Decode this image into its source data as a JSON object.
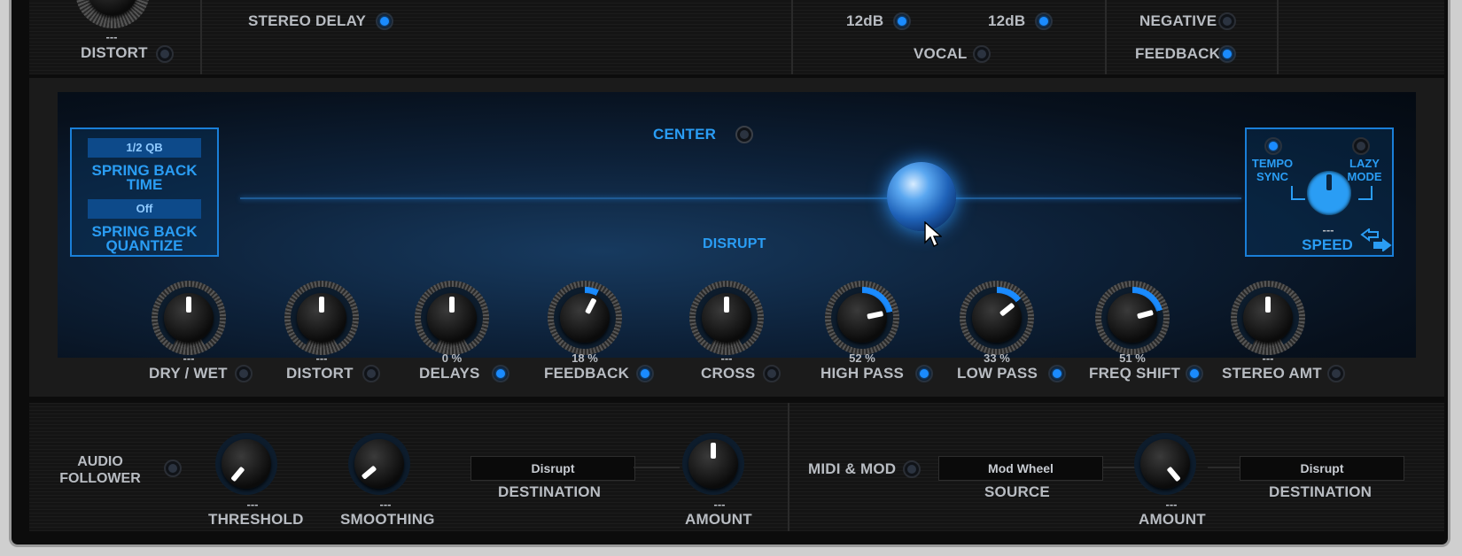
{
  "top": {
    "distort_value": "---",
    "distort_label": "DISTORT",
    "stereo_delay_label": "STEREO DELAY",
    "db_left": "12dB",
    "db_right": "12dB",
    "vocal_label": "VOCAL",
    "negative_label": "NEGATIVE",
    "feedback_label": "FEEDBACK"
  },
  "spring": {
    "time_value": "1/2 QB",
    "time_label_1": "SPRING BACK",
    "time_label_2": "TIME",
    "quantize_value": "Off",
    "quantize_label_1": "SPRING BACK",
    "quantize_label_2": "QUANTIZE"
  },
  "center_label": "CENTER",
  "disrupt_label": "DISRUPT",
  "speed": {
    "tempo_1": "TEMPO",
    "tempo_2": "SYNC",
    "lazy_1": "LAZY",
    "lazy_2": "MODE",
    "value": "---",
    "label": "SPEED"
  },
  "knobs": [
    {
      "label": "DRY / WET",
      "value": "---",
      "led_on": false,
      "level": 0.5
    },
    {
      "label": "DISTORT",
      "value": "---",
      "led_on": false,
      "level": 0.5
    },
    {
      "label": "DELAYS",
      "value": "0 %",
      "led_on": true,
      "level": 0.5
    },
    {
      "label": "FEEDBACK",
      "value": "18 %",
      "led_on": true,
      "level": 0.59
    },
    {
      "label": "CROSS",
      "value": "---",
      "led_on": false,
      "level": 0.5
    },
    {
      "label": "HIGH PASS",
      "value": "52 %",
      "led_on": true,
      "level": 0.76
    },
    {
      "label": "LOW PASS",
      "value": "33 %",
      "led_on": true,
      "level": 0.67
    },
    {
      "label": "FREQ SHIFT",
      "value": "51 %",
      "led_on": true,
      "level": 0.75
    },
    {
      "label": "STEREO AMT",
      "value": "---",
      "led_on": false,
      "level": 0.5
    }
  ],
  "bottom_left": {
    "follower_1": "AUDIO",
    "follower_2": "FOLLOWER",
    "threshold_value": "---",
    "threshold_label": "THRESHOLD",
    "smoothing_value": "---",
    "smoothing_label": "SMOOTHING",
    "destination_value": "Disrupt",
    "destination_label": "DESTINATION",
    "amount_value": "---",
    "amount_label": "AMOUNT"
  },
  "bottom_right": {
    "midi_label": "MIDI & MOD",
    "source_value": "Mod Wheel",
    "source_label": "SOURCE",
    "amount_value": "---",
    "amount_label": "AMOUNT",
    "destination_value": "Disrupt",
    "destination_label": "DESTINATION"
  },
  "colors": {
    "accent": "#1a8bff",
    "label": "#b8bcc2",
    "panel_blue": "#2a9df4"
  },
  "icons": [
    "swap-arrows-icon",
    "cursor-arrow-icon"
  ]
}
